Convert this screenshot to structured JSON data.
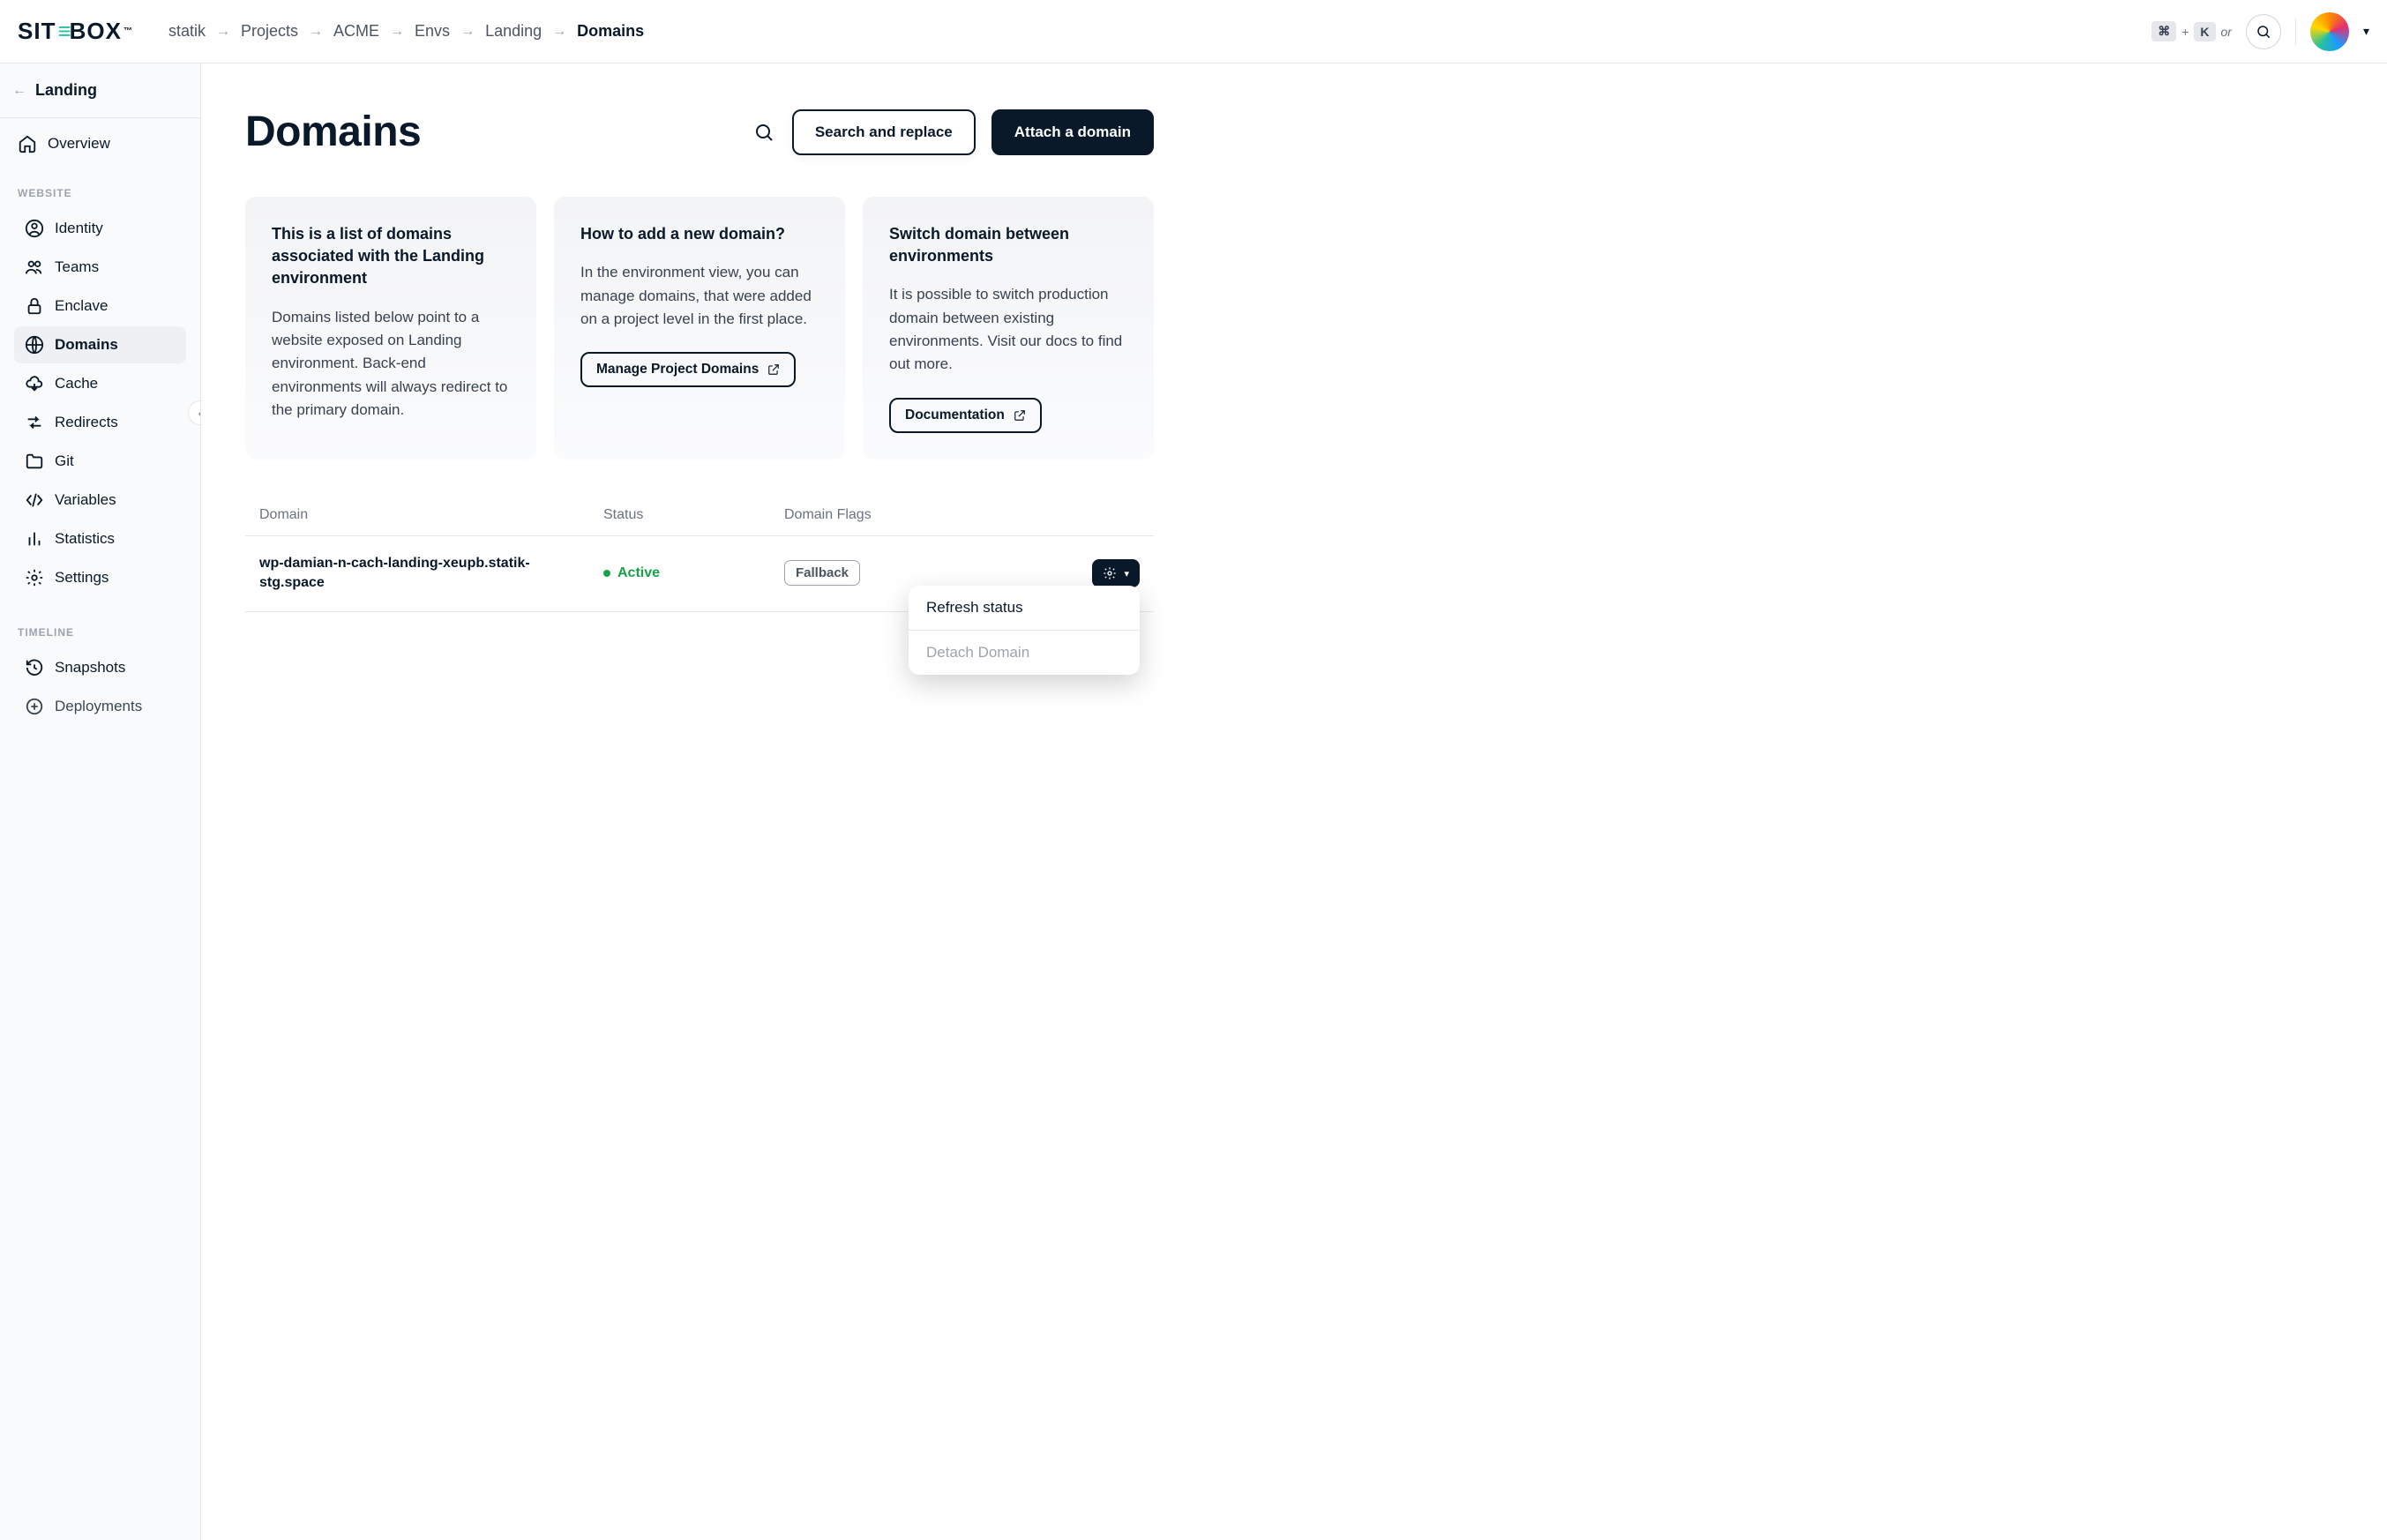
{
  "app": {
    "name_sit": "SIT",
    "name_e": "≡",
    "name_box": "BOX",
    "tm": "™"
  },
  "breadcrumbs": [
    {
      "label": "statik"
    },
    {
      "label": "Projects"
    },
    {
      "label": "ACME"
    },
    {
      "label": "Envs"
    },
    {
      "label": "Landing"
    },
    {
      "label": "Domains",
      "current": true
    }
  ],
  "kbd": {
    "cmd": "⌘",
    "plus": "+",
    "key": "K",
    "or": "or"
  },
  "sidebar": {
    "back_label": "Landing",
    "overview": "Overview",
    "section_website": "WEBSITE",
    "items_website": [
      {
        "label": "Identity",
        "icon": "user-circle-icon"
      },
      {
        "label": "Teams",
        "icon": "users-icon"
      },
      {
        "label": "Enclave",
        "icon": "lock-icon"
      },
      {
        "label": "Domains",
        "icon": "globe-icon",
        "active": true
      },
      {
        "label": "Cache",
        "icon": "cloud-icon"
      },
      {
        "label": "Redirects",
        "icon": "redirect-icon"
      },
      {
        "label": "Git",
        "icon": "folder-icon"
      },
      {
        "label": "Variables",
        "icon": "code-icon"
      },
      {
        "label": "Statistics",
        "icon": "bar-chart-icon"
      },
      {
        "label": "Settings",
        "icon": "gear-icon"
      }
    ],
    "section_timeline": "TIMELINE",
    "items_timeline": [
      {
        "label": "Snapshots",
        "icon": "history-icon"
      },
      {
        "label": "Deployments",
        "icon": "deploy-icon"
      }
    ]
  },
  "page": {
    "title": "Domains",
    "search_replace": "Search and replace",
    "attach": "Attach a domain"
  },
  "cards": [
    {
      "title": "This is a list of domains associated with the Landing environment",
      "body": "Domains listed below point to a website exposed on Landing environment. Back-end environments will always redirect to the primary domain."
    },
    {
      "title": "How to add a new domain?",
      "body": "In the environment view, you can manage domains, that were added on a project level in the first place.",
      "link": "Manage Project Domains"
    },
    {
      "title": "Switch domain between environments",
      "body": "It is possible to switch production domain between existing environments. Visit our docs to find out more.",
      "link": "Documentation"
    }
  ],
  "table": {
    "col_domain": "Domain",
    "col_status": "Status",
    "col_flags": "Domain Flags",
    "rows": [
      {
        "domain": "wp-damian-n-cach-landing-xeupb.statik-stg.space",
        "status": "Active",
        "flag": "Fallback"
      }
    ]
  },
  "dropdown": {
    "refresh": "Refresh status",
    "detach": "Detach Domain"
  }
}
